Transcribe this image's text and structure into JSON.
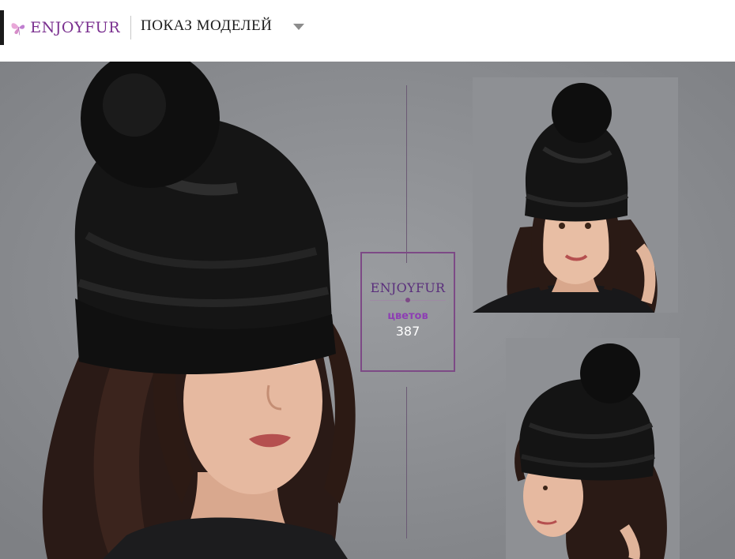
{
  "header": {
    "brand": "ENJOYFUR",
    "title": "ПОКАЗ МОДЕЛЕЙ"
  },
  "badge": {
    "brand": "ENJOYFUR",
    "label": "цветов",
    "number": "387"
  },
  "colors": {
    "brand_purple": "#7a2f8f",
    "badge_label": "#8d3fb3",
    "banner_bg": "#8a8c90"
  },
  "icons": [
    "butterfly-logo-icon",
    "dropdown-caret-icon"
  ]
}
